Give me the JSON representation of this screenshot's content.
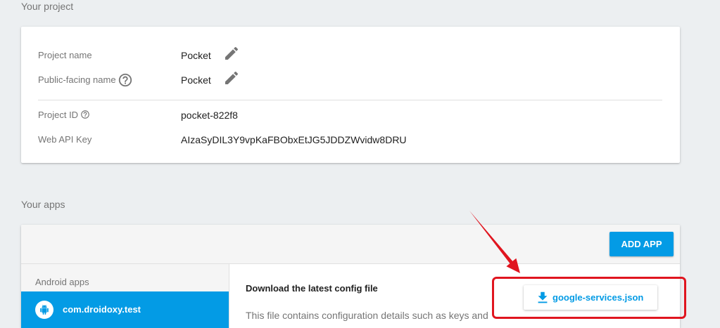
{
  "project": {
    "heading": "Your project",
    "fields": [
      {
        "label": "Project name",
        "value": "Pocket",
        "icons": [
          "edit-icon"
        ]
      },
      {
        "label": "Public-facing name",
        "value": "Pocket",
        "icons": [
          "help-icon",
          "edit-icon"
        ]
      },
      {
        "label": "Project ID",
        "value": "pocket-822f8",
        "icons": [
          "help-icon"
        ]
      },
      {
        "label": "Web API Key",
        "value": "AIzaSyDIL3Y9vpKaFBObxEtJG5JDDZWvidw8DRU",
        "icons": []
      }
    ]
  },
  "apps": {
    "heading": "Your apps",
    "add_app_button": "ADD APP",
    "sidebar": {
      "group_label": "Android apps",
      "items": [
        {
          "label": "com.droidoxy.test",
          "icon": "android-icon",
          "selected": true
        }
      ]
    },
    "config": {
      "title": "Download the latest config file",
      "description": "This file contains configuration details such as keys and",
      "download_button": "google-services.json",
      "download_icon": "download-icon"
    }
  },
  "annotation": {
    "color": "#e0151f"
  },
  "colors": {
    "page_background": "#eceff1",
    "accent": "#039be5",
    "label_text": "#757575",
    "value_text": "#212121",
    "panel_background": "#f5f5f5"
  }
}
